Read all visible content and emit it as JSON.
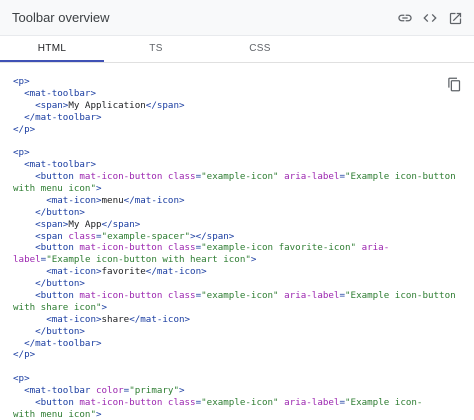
{
  "header": {
    "title": "Toolbar overview",
    "icons": [
      "link-icon",
      "code-icon",
      "open-in-new-icon"
    ]
  },
  "tabs": [
    {
      "label": "HTML",
      "active": true
    },
    {
      "label": "TS",
      "active": false
    },
    {
      "label": "CSS",
      "active": false
    }
  ],
  "code": {
    "copy_icon": "copy-icon",
    "lines": [
      [
        [
          "tag",
          "<p>"
        ]
      ],
      [
        [
          "tag",
          "  <mat-toolbar>"
        ]
      ],
      [
        [
          "tag",
          "    <span>"
        ],
        [
          "txt",
          "My Application"
        ],
        [
          "tag",
          "</span>"
        ]
      ],
      [
        [
          "tag",
          "  </mat-toolbar>"
        ]
      ],
      [
        [
          "tag",
          "</p>"
        ]
      ],
      [],
      [
        [
          "tag",
          "<p>"
        ]
      ],
      [
        [
          "tag",
          "  <mat-toolbar>"
        ]
      ],
      [
        [
          "tag",
          "    <button "
        ],
        [
          "attr",
          "mat-icon-button "
        ],
        [
          "attr",
          "class"
        ],
        [
          "tag",
          "="
        ],
        [
          "str",
          "\"example-icon\""
        ],
        [
          "tag",
          " "
        ],
        [
          "attr",
          "aria-label"
        ],
        [
          "tag",
          "="
        ],
        [
          "str",
          "\"Example icon-button"
        ]
      ],
      [
        [
          "str",
          "with menu icon\""
        ],
        [
          "tag",
          ">"
        ]
      ],
      [
        [
          "tag",
          "      <mat-icon>"
        ],
        [
          "txt",
          "menu"
        ],
        [
          "tag",
          "</mat-icon>"
        ]
      ],
      [
        [
          "tag",
          "    </button>"
        ]
      ],
      [
        [
          "tag",
          "    <span>"
        ],
        [
          "txt",
          "My App"
        ],
        [
          "tag",
          "</span>"
        ]
      ],
      [
        [
          "tag",
          "    <span "
        ],
        [
          "attr",
          "class"
        ],
        [
          "tag",
          "="
        ],
        [
          "str",
          "\"example-spacer\""
        ],
        [
          "tag",
          "></span>"
        ]
      ],
      [
        [
          "tag",
          "    <button "
        ],
        [
          "attr",
          "mat-icon-button "
        ],
        [
          "attr",
          "class"
        ],
        [
          "tag",
          "="
        ],
        [
          "str",
          "\"example-icon favorite-icon\""
        ],
        [
          "tag",
          " "
        ],
        [
          "attr",
          "aria-"
        ]
      ],
      [
        [
          "attr",
          "label"
        ],
        [
          "tag",
          "="
        ],
        [
          "str",
          "\"Example icon-button with heart icon\""
        ],
        [
          "tag",
          ">"
        ]
      ],
      [
        [
          "tag",
          "      <mat-icon>"
        ],
        [
          "txt",
          "favorite"
        ],
        [
          "tag",
          "</mat-icon>"
        ]
      ],
      [
        [
          "tag",
          "    </button>"
        ]
      ],
      [
        [
          "tag",
          "    <button "
        ],
        [
          "attr",
          "mat-icon-button "
        ],
        [
          "attr",
          "class"
        ],
        [
          "tag",
          "="
        ],
        [
          "str",
          "\"example-icon\""
        ],
        [
          "tag",
          " "
        ],
        [
          "attr",
          "aria-label"
        ],
        [
          "tag",
          "="
        ],
        [
          "str",
          "\"Example icon-button"
        ]
      ],
      [
        [
          "str",
          "with share icon\""
        ],
        [
          "tag",
          ">"
        ]
      ],
      [
        [
          "tag",
          "      <mat-icon>"
        ],
        [
          "txt",
          "share"
        ],
        [
          "tag",
          "</mat-icon>"
        ]
      ],
      [
        [
          "tag",
          "    </button>"
        ]
      ],
      [
        [
          "tag",
          "  </mat-toolbar>"
        ]
      ],
      [
        [
          "tag",
          "</p>"
        ]
      ],
      [],
      [
        [
          "tag",
          "<p>"
        ]
      ],
      [
        [
          "tag",
          "  <mat-toolbar "
        ],
        [
          "attr",
          "color"
        ],
        [
          "tag",
          "="
        ],
        [
          "str",
          "\"primary\""
        ],
        [
          "tag",
          ">"
        ]
      ],
      [
        [
          "tag",
          "    <button "
        ],
        [
          "attr",
          "mat-icon-button "
        ],
        [
          "attr",
          "class"
        ],
        [
          "tag",
          "="
        ],
        [
          "str",
          "\"example-icon\""
        ],
        [
          "tag",
          " "
        ],
        [
          "attr",
          "aria-label"
        ],
        [
          "tag",
          "="
        ],
        [
          "str",
          "\"Example icon-"
        ]
      ],
      [
        [
          "str",
          "with menu icon\""
        ],
        [
          "tag",
          ">"
        ]
      ]
    ]
  }
}
